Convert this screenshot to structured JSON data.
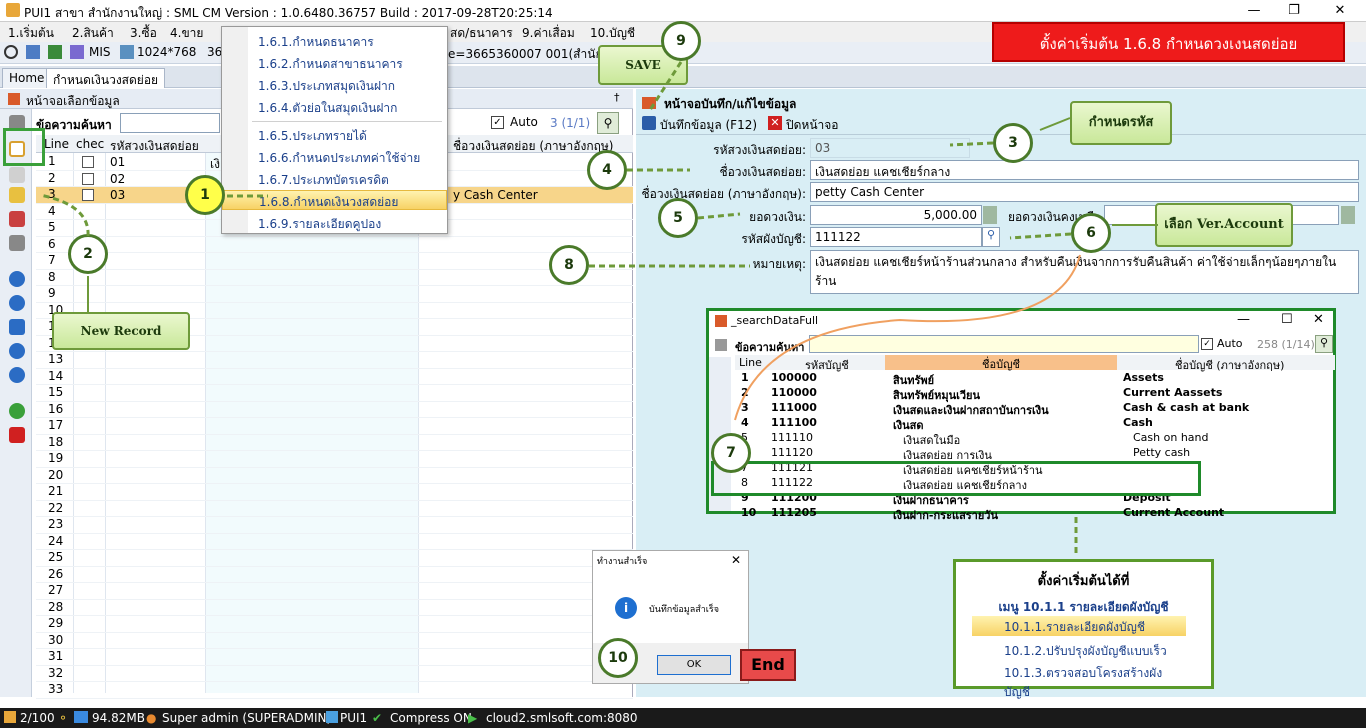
{
  "window": {
    "title": "PUI1 สาขา สำนักงานใหญ่ : SML CM Version : 1.0.6480.36757  Build : 2017-09-28T20:25:14"
  },
  "menubar": [
    "1.เริ่มต้น",
    "2.สินค้า",
    "3.ซื้อ",
    "4.ขาย",
    "สด/ธนาคาร",
    "9.ค่าเสื่อม",
    "10.บัญชี"
  ],
  "toolbar": {
    "mis": "MIS",
    "resolution": "1024*768",
    "num": "36",
    "db": "e=3665360007 001(สำนักง"
  },
  "tabs": [
    "Home",
    "กำหนดเงินวงสดย่อย"
  ],
  "left": {
    "header": "หน้าจอเลือกข้อมูล",
    "search_label": "ข้อความค้นหา",
    "auto": "Auto",
    "count": "3 (1/1)",
    "columns": [
      "Line",
      "chec",
      "รหัสวงเงินสดย่อย",
      "ชื่อวงเงินสดย่อย (ภาษาอังกฤษ)"
    ],
    "rows": [
      {
        "line": "1",
        "code": "01",
        "name": "เงิ",
        "name_en": ""
      },
      {
        "line": "2",
        "code": "02",
        "name": "",
        "name_en": ""
      },
      {
        "line": "3",
        "code": "03",
        "name": "",
        "name_en": "y Cash Center"
      }
    ],
    "empty_lines": [
      "4",
      "5",
      "6",
      "7",
      "8",
      "9",
      "10",
      "11",
      "12",
      "13",
      "14",
      "15",
      "16",
      "17",
      "18",
      "19",
      "20",
      "21",
      "22",
      "23",
      "24",
      "25",
      "26",
      "27",
      "28",
      "29",
      "30",
      "31",
      "32",
      "33"
    ]
  },
  "dropdown": [
    "1.6.1.กำหนดธนาคาร",
    "1.6.2.กำหนดสาขาธนาคาร",
    "1.6.3.ประเภทสมุดเงินฝาก",
    "1.6.4.ตัวย่อในสมุดเงินฝาก",
    "1.6.5.ประเภทรายได้",
    "1.6.6.กำหนดประเภทค่าใช้จ่าย",
    "1.6.7.ประเภทบัตรเครดิต",
    "1.6.8.กำหนดเงินวงสดย่อย",
    "1.6.9.รายละเอียดคูปอง"
  ],
  "right": {
    "header": "หน้าจอบันทึก/แก้ไขข้อมูล",
    "save_btn": "บันทึกข้อมูล (F12)",
    "close_btn": "ปิดหน้าจอ",
    "code_label": "รหัสวงเงินสดย่อย:",
    "code_value": "03",
    "name_label": "ชื่อวงเงินสดย่อย:",
    "name_value": "เงินสดย่อย แคชเชียร์กลาง",
    "name_en_label": "ชื่อวงเงินสดย่อย (ภาษาอังกฤษ):",
    "name_en_value": "petty Cash Center",
    "amount_label": "ยอดวงเงิน:",
    "amount_value": "5,000.00",
    "remain_label": "ยอดวงเงินคงเหลื",
    "account_label": "รหัสผังบัญชี:",
    "account_value": "111122",
    "note_label": "หมายเหตุ:",
    "note_value": "เงินสดย่อย  แคชเชียร์หน้าร้านส่วนกลาง  สำหรับคืนเงินจากการรับคืนสินค้า ค่าใช้จ่ายเล็กๆน้อยๆภายในร้าน"
  },
  "search_window": {
    "title": "_searchDataFull",
    "search_label": "ข้อความค้นหา",
    "auto": "Auto",
    "count": "258 (1/14)",
    "columns": [
      "Line",
      "รหัสบัญชี",
      "ชื่อบัญชี",
      "ชื่อบัญชี (ภาษาอังกฤษ)"
    ],
    "rows": [
      {
        "line": "1",
        "code": "100000",
        "name": "สินทรัพย์",
        "en": "Assets",
        "bold": true
      },
      {
        "line": "2",
        "code": "110000",
        "name": "สินทรัพย์หมุนเวียน",
        "en": "Current Aassets",
        "bold": true
      },
      {
        "line": "3",
        "code": "111000",
        "name": "เงินสดและเงินฝากสถาบันการเงิน",
        "en": "Cash & cash at bank",
        "bold": true
      },
      {
        "line": "4",
        "code": "111100",
        "name": "เงินสด",
        "en": "Cash",
        "bold": true
      },
      {
        "line": "5",
        "code": "111110",
        "name": "เงินสดในมือ",
        "en": "Cash on hand",
        "bold": false
      },
      {
        "line": "6",
        "code": "111120",
        "name": "เงินสดย่อย  การเงิน",
        "en": "Petty cash",
        "bold": false
      },
      {
        "line": "7",
        "code": "111121",
        "name": "เงินสดย่อย  แคชเชียร์หน้าร้าน",
        "en": "",
        "bold": false
      },
      {
        "line": "8",
        "code": "111122",
        "name": "เงินสดย่อย แคชเชียร์กลาง",
        "en": "",
        "bold": false
      },
      {
        "line": "9",
        "code": "111200",
        "name": "เงินฝากธนาคาร",
        "en": "Deposit",
        "bold": true
      },
      {
        "line": "10",
        "code": "111205",
        "name": "เงินฝาก-กระแสรายวัน",
        "en": "Current Account",
        "bold": true
      }
    ]
  },
  "menu_hint": {
    "title": "ตั้งค่าเริ่มต้นได้ที่",
    "subtitle": "เมนู 10.1.1 รายละเอียดผังบัญชี",
    "items": [
      "10.1.1.รายละเอียดผังบัญชี",
      "10.1.2.ปรับปรุงผังบัญชีแบบเร็ว",
      "10.1.3.ตรวจสอบโครงสร้างผังบัญชี"
    ]
  },
  "dialog": {
    "title": "ทำงานสำเร็จ",
    "message": "บันทึกข้อมูลสำเร็จ",
    "ok": "OK"
  },
  "annotations": {
    "banner": "ตั้งค่าเริ่มต้น  1.6.8 กำหนดวงเงนสดย่อย",
    "save": "SAVE",
    "new_record": "New Record",
    "set_code": "กำหนดรหัส",
    "select_account": "เลือก Ver.Account",
    "end": "End",
    "numbers": [
      "1",
      "2",
      "3",
      "4",
      "5",
      "6",
      "7",
      "8",
      "9",
      "10"
    ]
  },
  "status": {
    "pages": "2/100",
    "memory": "94.82MB",
    "user": "Super admin (SUPERADMIN)",
    "branch": "PUI1",
    "compress": "Compress ON",
    "server": "cloud2.smlsoft.com:8080"
  },
  "colors": {
    "accent": "#1f8a2a",
    "banner": "#ee1b1b",
    "callout_border": "#6e9a3a"
  }
}
